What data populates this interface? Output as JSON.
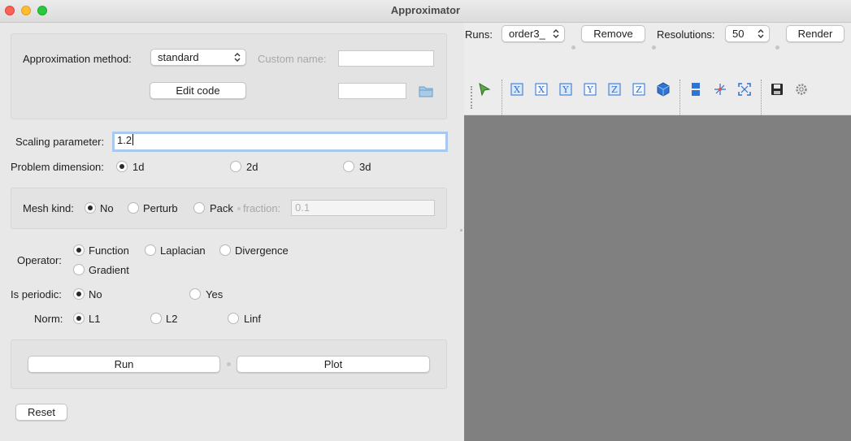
{
  "window": {
    "title": "Approximator"
  },
  "approx_group": {
    "method_label": "Approximation method:",
    "method_value": "standard",
    "custom_name_label": "Custom name:",
    "custom_name_value": "",
    "edit_code_label": "Edit code",
    "file_path_value": ""
  },
  "scaling": {
    "label": "Scaling parameter:",
    "value": "1.2"
  },
  "dimension": {
    "label": "Problem dimension:",
    "options": [
      "1d",
      "2d",
      "3d"
    ],
    "selected": "1d"
  },
  "mesh": {
    "label": "Mesh kind:",
    "options": [
      "No",
      "Perturb",
      "Pack"
    ],
    "selected": "No",
    "fraction_label": "fraction:",
    "fraction_value": "0.1"
  },
  "operator": {
    "label": "Operator:",
    "options": [
      "Function",
      "Laplacian",
      "Divergence",
      "Gradient"
    ],
    "selected": "Function"
  },
  "periodic": {
    "label": "Is periodic:",
    "options": [
      "No",
      "Yes"
    ],
    "selected": "No"
  },
  "norm": {
    "label": "Norm:",
    "options": [
      "L1",
      "L2",
      "Linf"
    ],
    "selected": "L1"
  },
  "actions": {
    "run_label": "Run",
    "plot_label": "Plot",
    "reset_label": "Reset"
  },
  "right_panel": {
    "runs_label": "Runs:",
    "runs_value": "order3_",
    "remove_label": "Remove",
    "resolutions_label": "Resolutions:",
    "resolutions_value": "50",
    "render_label": "Render"
  },
  "toolbar_icons": [
    "pointer-icon",
    "view-x-plus-icon",
    "view-x-minus-icon",
    "view-y-plus-icon",
    "view-y-minus-icon",
    "view-z-plus-icon",
    "view-z-minus-icon",
    "isometric-cube-icon",
    "layout-icon",
    "axes-icon",
    "fit-view-icon",
    "save-icon",
    "settings-icon"
  ],
  "colors": {
    "viewport_bg": "#808080",
    "focus_ring": "#a9c8ef",
    "toolbar_blue": "#2b6fcf"
  }
}
